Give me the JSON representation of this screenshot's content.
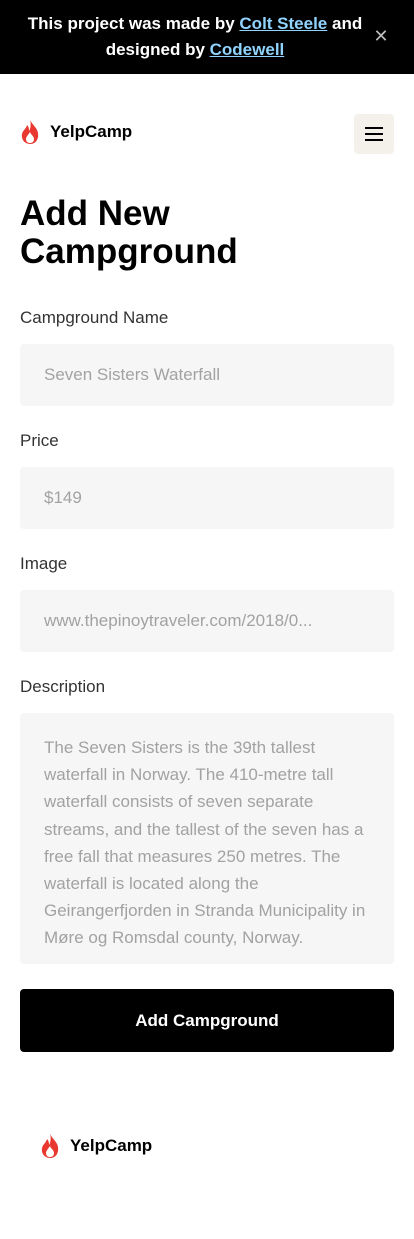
{
  "banner": {
    "text_part1": "This project was made by ",
    "author_link": "Colt Steele",
    "text_part2": " and designed by ",
    "designer_link": "Codewell",
    "close_symbol": "✕"
  },
  "header": {
    "logo_text": "YelpCamp",
    "menu_icon": "hamburger-menu-icon"
  },
  "page": {
    "title": "Add New Campground"
  },
  "form": {
    "name": {
      "label": "Campground Name",
      "value": "Seven Sisters Waterfall"
    },
    "price": {
      "label": "Price",
      "value": "$149"
    },
    "image": {
      "label": "Image",
      "value": "www.thepinoytraveler.com/2018/0..."
    },
    "description": {
      "label": "Description",
      "value": "The Seven Sisters is the 39th tallest waterfall in Norway. The 410-metre tall waterfall consists of seven separate streams, and the tallest of the seven has a free fall that measures 250 metres. The waterfall is located along the Geirangerfjorden in Stranda Municipality in Møre og Romsdal county, Norway."
    },
    "submit_label": "Add Campground"
  },
  "footer": {
    "logo_text": "YelpCamp"
  },
  "colors": {
    "banner_bg": "#000000",
    "link": "#8fd3fe",
    "flame": "#e8382f",
    "field_bg": "#f6f6f6",
    "menu_button_bg": "#f4f1ea"
  }
}
